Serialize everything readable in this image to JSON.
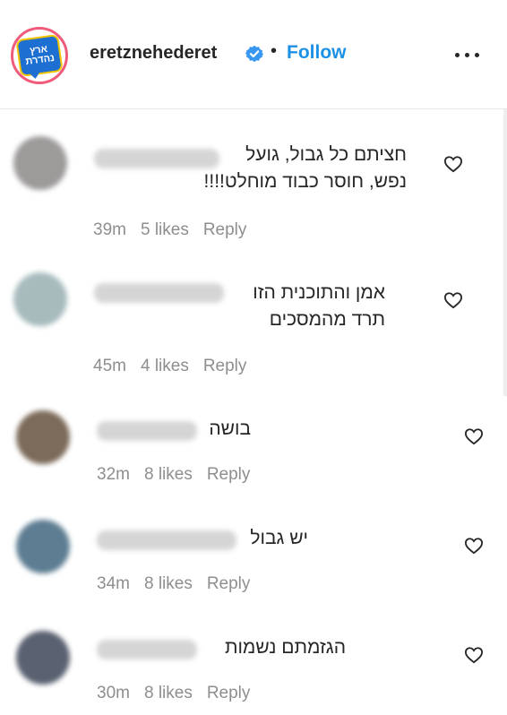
{
  "post_header": {
    "username": "eretznehederet",
    "separator": "•",
    "follow_label": "Follow",
    "logo_text": "ארץ נהדרת"
  },
  "comments": [
    {
      "text": "חציתם כל גבול, גועל\nנפש, חוסר כבוד מוחלט!!!!",
      "time": "39m",
      "likes": "5 likes",
      "reply": "Reply"
    },
    {
      "text": "אמן והתוכנית הזו\nתרד מהמסכים",
      "time": "45m",
      "likes": "4 likes",
      "reply": "Reply"
    },
    {
      "text": "בושה",
      "time": "32m",
      "likes": "8 likes",
      "reply": "Reply"
    },
    {
      "text": "יש גבול",
      "time": "34m",
      "likes": "8 likes",
      "reply": "Reply"
    },
    {
      "text": "הגזמתם נשמות",
      "time": "30m",
      "likes": "8 likes",
      "reply": "Reply"
    }
  ],
  "colors": {
    "accent": "#1d91e6",
    "secondary_text": "#8e8e8e",
    "story_ring": "#ef5b7b",
    "verified": "#3897f0"
  }
}
